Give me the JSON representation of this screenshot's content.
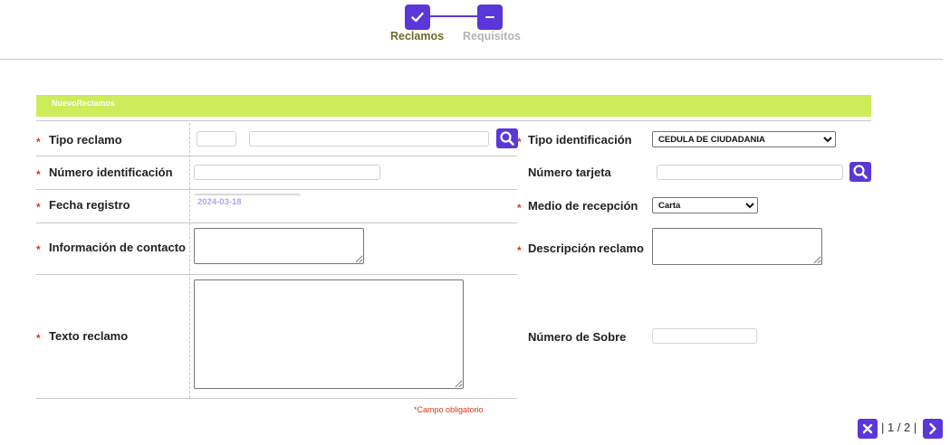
{
  "stepper": {
    "steps": [
      {
        "label": "Reclamos",
        "state": "completed",
        "icon": "check-icon",
        "color": "#6b6b2a"
      },
      {
        "label": "Requisitos",
        "state": "current",
        "icon": "minus-icon",
        "color": "#b3b3b3"
      }
    ],
    "accent": "#5b36d9"
  },
  "section": {
    "title": "NuevoReclamos",
    "color": "#ccec5a"
  },
  "left": {
    "tipo_reclamo": {
      "label": "Tipo reclamo",
      "code_value": "",
      "name_value": "",
      "search_icon": "search-icon"
    },
    "numero_identificacion": {
      "label": "Número identificación",
      "value": ""
    },
    "fecha_registro": {
      "label": "Fecha registro",
      "value": "2024-03-18"
    },
    "informacion_contacto": {
      "label": "Información de contacto",
      "value": ""
    },
    "texto_reclamo": {
      "label": "Texto reclamo",
      "value": ""
    }
  },
  "right": {
    "tipo_identificacion": {
      "label": "Tipo identificación",
      "selected": "CEDULA DE CIUDADANIA"
    },
    "numero_tarjeta": {
      "label": "Número tarjeta",
      "value": "",
      "search_icon": "search-icon"
    },
    "medio_recepcion": {
      "label": "Medio de recepción",
      "selected": "Carta"
    },
    "descripcion_reclamo": {
      "label": "Descripción reclamo",
      "value": ""
    },
    "numero_sobre": {
      "label": "Número de Sobre",
      "value": ""
    }
  },
  "required_marker": "*",
  "required_note": "*Campo obligatorio",
  "pager": {
    "text": "| 1 / 2 |",
    "close_icon": "close-icon",
    "next_icon": "chevron-right-icon"
  }
}
